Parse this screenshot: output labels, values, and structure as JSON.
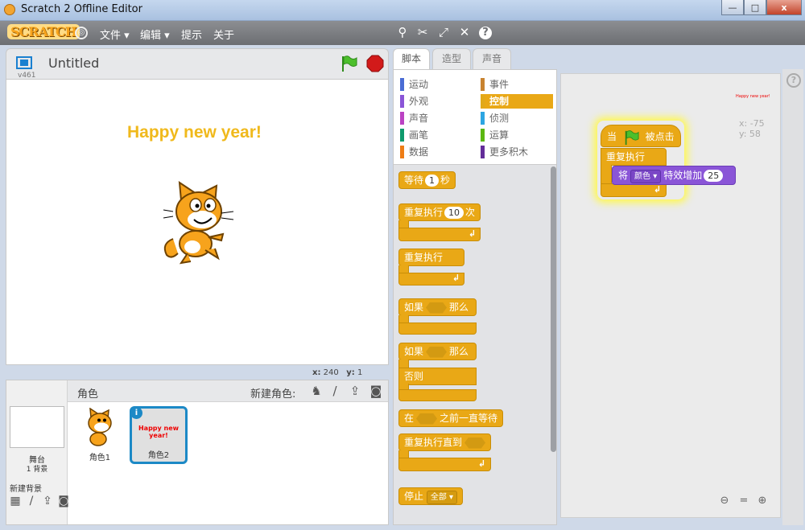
{
  "window": {
    "title": "Scratch 2 Offline Editor",
    "min_glyph": "—",
    "max_glyph": "□",
    "close_glyph": "x"
  },
  "menubar": {
    "logo": "SCRATCH",
    "items": [
      "文件 ▾",
      "编辑 ▾",
      "提示",
      "关于"
    ],
    "tools": [
      "duplicate-icon",
      "delete-icon",
      "grow-icon",
      "shrink-icon",
      "help-icon"
    ]
  },
  "stage": {
    "version": "v461",
    "project_title": "Untitled",
    "text": "Happy new year!",
    "coords": {
      "x_label": "x:",
      "x": "240",
      "y_label": "y:",
      "y": "1"
    }
  },
  "sprites": {
    "header": "角色",
    "new_sprite_label": "新建角色:",
    "stage_label": "舞台",
    "backdrop_count": "1 背景",
    "new_backdrop": "新建背景",
    "items": [
      {
        "name": "角色1",
        "selected": false
      },
      {
        "name": "角色2",
        "selected": true,
        "text": "Happy new year!"
      }
    ]
  },
  "tabs": [
    "脚本",
    "造型",
    "声音"
  ],
  "categories": [
    {
      "label": "运动",
      "color": "#4a6cd4"
    },
    {
      "label": "事件",
      "color": "#c88330"
    },
    {
      "label": "外观",
      "color": "#8a55d7"
    },
    {
      "label": "控制",
      "color": "#e1a91a",
      "active": true
    },
    {
      "label": "声音",
      "color": "#bb42c3"
    },
    {
      "label": "侦测",
      "color": "#2ca5e2"
    },
    {
      "label": "画笔",
      "color": "#0e9a6c"
    },
    {
      "label": "运算",
      "color": "#5cb712"
    },
    {
      "label": "数据",
      "color": "#ee7d16"
    },
    {
      "label": "更多积木",
      "color": "#632d99"
    }
  ],
  "blocks": {
    "wait": {
      "a": "等待",
      "n": "1",
      "b": "秒"
    },
    "repeat": {
      "a": "重复执行",
      "n": "10",
      "b": "次"
    },
    "forever": "重复执行",
    "if_then": {
      "a": "如果",
      "b": "那么"
    },
    "if_else": {
      "a": "如果",
      "b": "那么",
      "else": "否则"
    },
    "wait_until": {
      "a": "在",
      "b": "之前一直等待"
    },
    "repeat_until": "重复执行直到",
    "stop": {
      "a": "停止",
      "dd": "全部 ▾"
    }
  },
  "script": {
    "hat": {
      "a": "当",
      "b": "被点击"
    },
    "forever": "重复执行",
    "change_effect": {
      "a": "将",
      "dd": "颜色 ▾",
      "b": "特效增加",
      "n": "25"
    }
  },
  "sprite_info": {
    "preview": "Happy new year!",
    "x": "x: -75",
    "y": "y: 58"
  },
  "colors": {
    "control": "#e9a816",
    "looks": "#8a55d7",
    "selected": "#1c89c6"
  }
}
